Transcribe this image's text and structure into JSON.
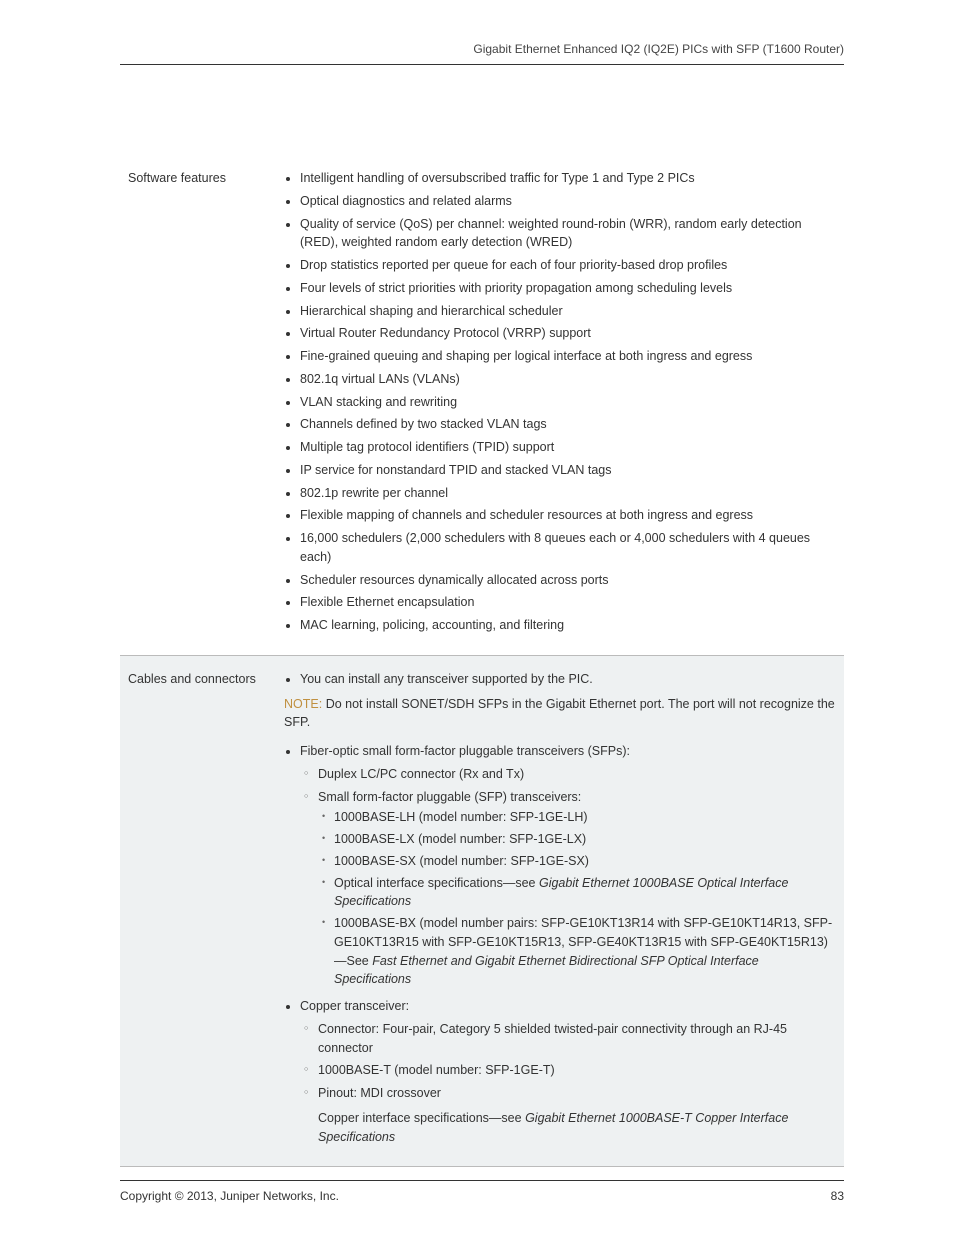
{
  "header": {
    "title": "Gigabit Ethernet Enhanced IQ2 (IQ2E) PICs with SFP (T1600 Router)"
  },
  "rows": {
    "software": {
      "label": "Software features",
      "items": [
        "Intelligent handling of oversubscribed traffic for Type 1 and Type 2 PICs",
        "Optical diagnostics and related alarms",
        "Quality of service (QoS) per channel: weighted round-robin (WRR), random early detection (RED), weighted random early detection (WRED)",
        "Drop statistics reported per queue for each of four priority-based drop profiles",
        "Four levels of strict priorities with priority propagation among scheduling levels",
        "Hierarchical shaping and hierarchical scheduler",
        "Virtual Router Redundancy Protocol (VRRP) support",
        "Fine-grained queuing and shaping per logical interface at both ingress and egress",
        "802.1q virtual LANs (VLANs)",
        "VLAN stacking and rewriting",
        "Channels defined by two stacked VLAN tags",
        "Multiple tag protocol identifiers (TPID) support",
        "IP service for nonstandard TPID and stacked VLAN tags",
        "802.1p rewrite per channel",
        "Flexible mapping of channels and scheduler resources at both ingress and egress",
        "16,000 schedulers (2,000 schedulers with 8 queues each or 4,000 schedulers with 4 queues each)",
        "Scheduler resources dynamically allocated across ports",
        "Flexible Ethernet encapsulation",
        "MAC learning, policing, accounting, and filtering"
      ]
    },
    "cables": {
      "label": "Cables and connectors",
      "first_item": "You can install any transceiver supported by the PIC.",
      "note_label": "NOTE:",
      "note_text": "Do not install SONET/SDH SFPs in the Gigabit Ethernet port. The port will not recognize the SFP.",
      "fiber_item": "Fiber-optic small form-factor pluggable transceivers (SFPs):",
      "fiber_sub": {
        "duplex": "Duplex LC/PC connector (Rx and Tx)",
        "sfp_header": "Small form-factor pluggable (SFP) transceivers:",
        "sfp_items": [
          "1000BASE-LH (model number: SFP-1GE-LH)",
          "1000BASE-LX (model number: SFP-1GE-LX)",
          "1000BASE-SX (model number: SFP-1GE-SX)"
        ],
        "optical_text1": "Optical interface specifications—see ",
        "optical_em": "Gigabit Ethernet 1000BASE Optical Interface Specifications",
        "bx_text1": "1000BASE-BX (model number pairs: SFP-GE10KT13R14 with SFP-GE10KT14R13, SFP-GE10KT13R15 with SFP-GE10KT15R13, SFP-GE40KT13R15 with SFP-GE40KT15R13)—See ",
        "bx_em": "Fast Ethernet and Gigabit Ethernet Bidirectional SFP Optical Interface Specifications"
      },
      "copper_item": "Copper transceiver:",
      "copper_sub": {
        "connector": "Connector: Four-pair, Category 5 shielded twisted-pair connectivity through an RJ-45 connector",
        "bt": "1000BASE-T (model number: SFP-1GE-T)",
        "pinout": "Pinout: MDI crossover",
        "spec_text1": "Copper interface specifications—see ",
        "spec_em": "Gigabit Ethernet 1000BASE-T Copper Interface Specifications"
      }
    }
  },
  "footer": {
    "copyright": "Copyright © 2013, Juniper Networks, Inc.",
    "page": "83"
  }
}
